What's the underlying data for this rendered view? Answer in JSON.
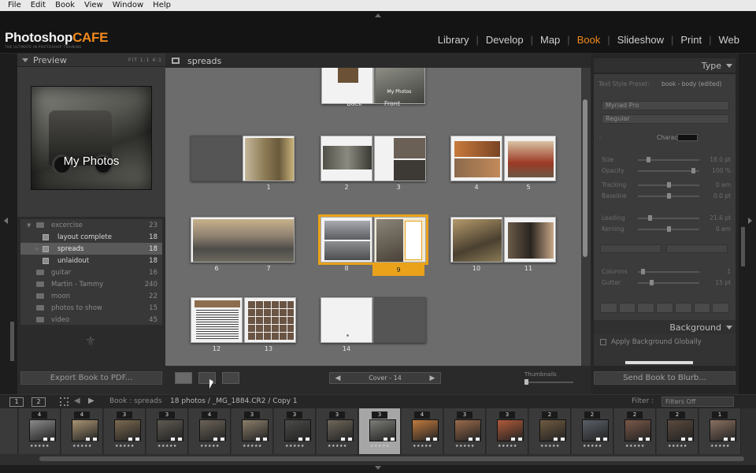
{
  "menu": [
    "File",
    "Edit",
    "Book",
    "View",
    "Window",
    "Help"
  ],
  "logo": {
    "main": "Photoshop",
    "accent": "CAFE",
    "tagline": "THE ULTIMATE IN PHOTOSHOP TRAINING"
  },
  "modules": [
    {
      "label": "Library",
      "active": false
    },
    {
      "label": "Develop",
      "active": false
    },
    {
      "label": "Map",
      "active": false
    },
    {
      "label": "Book",
      "active": true
    },
    {
      "label": "Slideshow",
      "active": false
    },
    {
      "label": "Print",
      "active": false
    },
    {
      "label": "Web",
      "active": false
    }
  ],
  "preview": {
    "title": "Preview",
    "options": "FIT  1:1  4:1",
    "photo_caption": "My Photos"
  },
  "collections": [
    {
      "label": "excercise",
      "count": "23",
      "kind": "folder",
      "state": "open"
    },
    {
      "label": "layout complete",
      "count": "18",
      "kind": "book",
      "state": "bright"
    },
    {
      "label": "spreads",
      "count": "18",
      "kind": "book",
      "state": "selected"
    },
    {
      "label": "unlaidout",
      "count": "18",
      "kind": "book",
      "state": "bright"
    },
    {
      "label": "guitar",
      "count": "16",
      "kind": "folder",
      "state": "normal"
    },
    {
      "label": "Martin - Tammy",
      "count": "240",
      "kind": "folder",
      "state": "normal"
    },
    {
      "label": "moon",
      "count": "22",
      "kind": "folder",
      "state": "normal"
    },
    {
      "label": "photos to show",
      "count": "15",
      "kind": "folder",
      "state": "normal"
    },
    {
      "label": "video",
      "count": "45",
      "kind": "folder",
      "state": "normal"
    }
  ],
  "export_button": "Export Book to PDF...",
  "center": {
    "title": "spreads",
    "cover_labels": [
      "Back",
      "Front"
    ],
    "cover_text": "My Photos",
    "page_numbers": [
      "1",
      "2",
      "3",
      "4",
      "5",
      "6",
      "7",
      "8",
      "9",
      "10",
      "11",
      "12",
      "13",
      "14"
    ],
    "pager_label": "Cover - 14",
    "thumbnails_label": "Thumbnails"
  },
  "type_panel": {
    "title": "Type",
    "preset_label": "Text Style Preset:",
    "preset_value": "book - body (edited)",
    "font": "Myriad Pro",
    "style": "Regular",
    "character_label": "Character",
    "sliders": [
      {
        "label": "Size",
        "value": "18.0 pt",
        "pos": 0.15
      },
      {
        "label": "Opacity",
        "value": "100 %",
        "pos": 0.92
      },
      {
        "label": "Tracking",
        "value": "0 em",
        "pos": 0.5
      },
      {
        "label": "Baseline",
        "value": "0.0 pt",
        "pos": 0.5
      },
      {
        "label": "Leading",
        "value": "21.6 pt",
        "pos": 0.18
      },
      {
        "label": "Kerning",
        "value": "0 em",
        "pos": 0.5
      },
      {
        "label": "Columns",
        "value": "1",
        "pos": 0.05
      },
      {
        "label": "Gutter",
        "value": "15 pt",
        "pos": 0.2
      }
    ]
  },
  "background_panel": {
    "title": "Background",
    "apply_label": "Apply Background Globally"
  },
  "blurb_button": "Send Book to Blurb...",
  "film_bar": {
    "view1": "1",
    "view2": "2",
    "source": "Book : spreads",
    "count": "18 photos / _MG_1884.CR2 / Copy 1",
    "filter_label": "Filter :",
    "filter_value": "Filters Off"
  },
  "filmstrip": [
    {
      "badge": "4",
      "stars": "★★★★★",
      "color": "#8a8a8a",
      "selected": false
    },
    {
      "badge": "4",
      "stars": "★★★★★",
      "color": "#a99472",
      "selected": false
    },
    {
      "badge": "3",
      "stars": "★★★★★",
      "color": "#7b6a50",
      "selected": false
    },
    {
      "badge": "3",
      "stars": "★★★★★",
      "color": "#5f5a52",
      "selected": false
    },
    {
      "badge": "4",
      "stars": "★★★★★",
      "color": "#6b6358",
      "selected": false
    },
    {
      "badge": "3",
      "stars": "★★★★★",
      "color": "#8b7e6a",
      "selected": false
    },
    {
      "badge": "3",
      "stars": "★★★★★",
      "color": "#4a4a48",
      "selected": false
    },
    {
      "badge": "3",
      "stars": "★★★★★",
      "color": "#6f675a",
      "selected": false
    },
    {
      "badge": "3",
      "stars": "★★★★★",
      "color": "#7d7d78",
      "selected": true
    },
    {
      "badge": "4",
      "stars": "★★★★★",
      "color": "#c07a3e",
      "selected": false
    },
    {
      "badge": "3",
      "stars": "★★★★★",
      "color": "#9a6a4a",
      "selected": false
    },
    {
      "badge": "3",
      "stars": "★★★★★",
      "color": "#b05a3a",
      "selected": false
    },
    {
      "badge": "2",
      "stars": "★★★★★",
      "color": "#6e5a40",
      "selected": false
    },
    {
      "badge": "2",
      "stars": "★★★★★",
      "color": "#5a6068",
      "selected": false
    },
    {
      "badge": "2",
      "stars": "★★★★★",
      "color": "#7a5848",
      "selected": false
    },
    {
      "badge": "2",
      "stars": "★★★★★",
      "color": "#5a4a3e",
      "selected": false
    },
    {
      "badge": "1",
      "stars": "★★★★★",
      "color": "#8a7060",
      "selected": false
    }
  ]
}
